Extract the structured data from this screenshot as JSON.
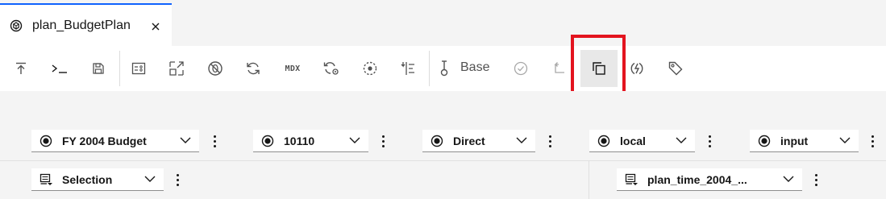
{
  "tab": {
    "title": "plan_BudgetPlan"
  },
  "toolbar": {
    "base_label": "Base",
    "mdx_label": "MDX",
    "buttons": [
      "export-icon",
      "terminal-icon",
      "save-icon",
      "properties-icon",
      "resize-icon",
      "suppress-zeros-icon",
      "refresh-icon",
      "mdx-icon",
      "recalculate-icon",
      "dimension-icon",
      "sort-icon",
      "sandbox-icon",
      "commit-icon",
      "undo-icon",
      "copy-icon",
      "stream-icon",
      "tag-icon"
    ]
  },
  "context": {
    "row1": [
      {
        "label": "FY 2004 Budget"
      },
      {
        "label": "10110"
      },
      {
        "label": "Direct"
      },
      {
        "label": "local"
      },
      {
        "label": "input"
      }
    ],
    "row2": [
      {
        "label": "Selection"
      },
      {
        "label": "plan_time_2004_..."
      }
    ]
  },
  "colors": {
    "accent": "#0f62fe",
    "highlight": "#e3141f",
    "icon": "#525252"
  }
}
